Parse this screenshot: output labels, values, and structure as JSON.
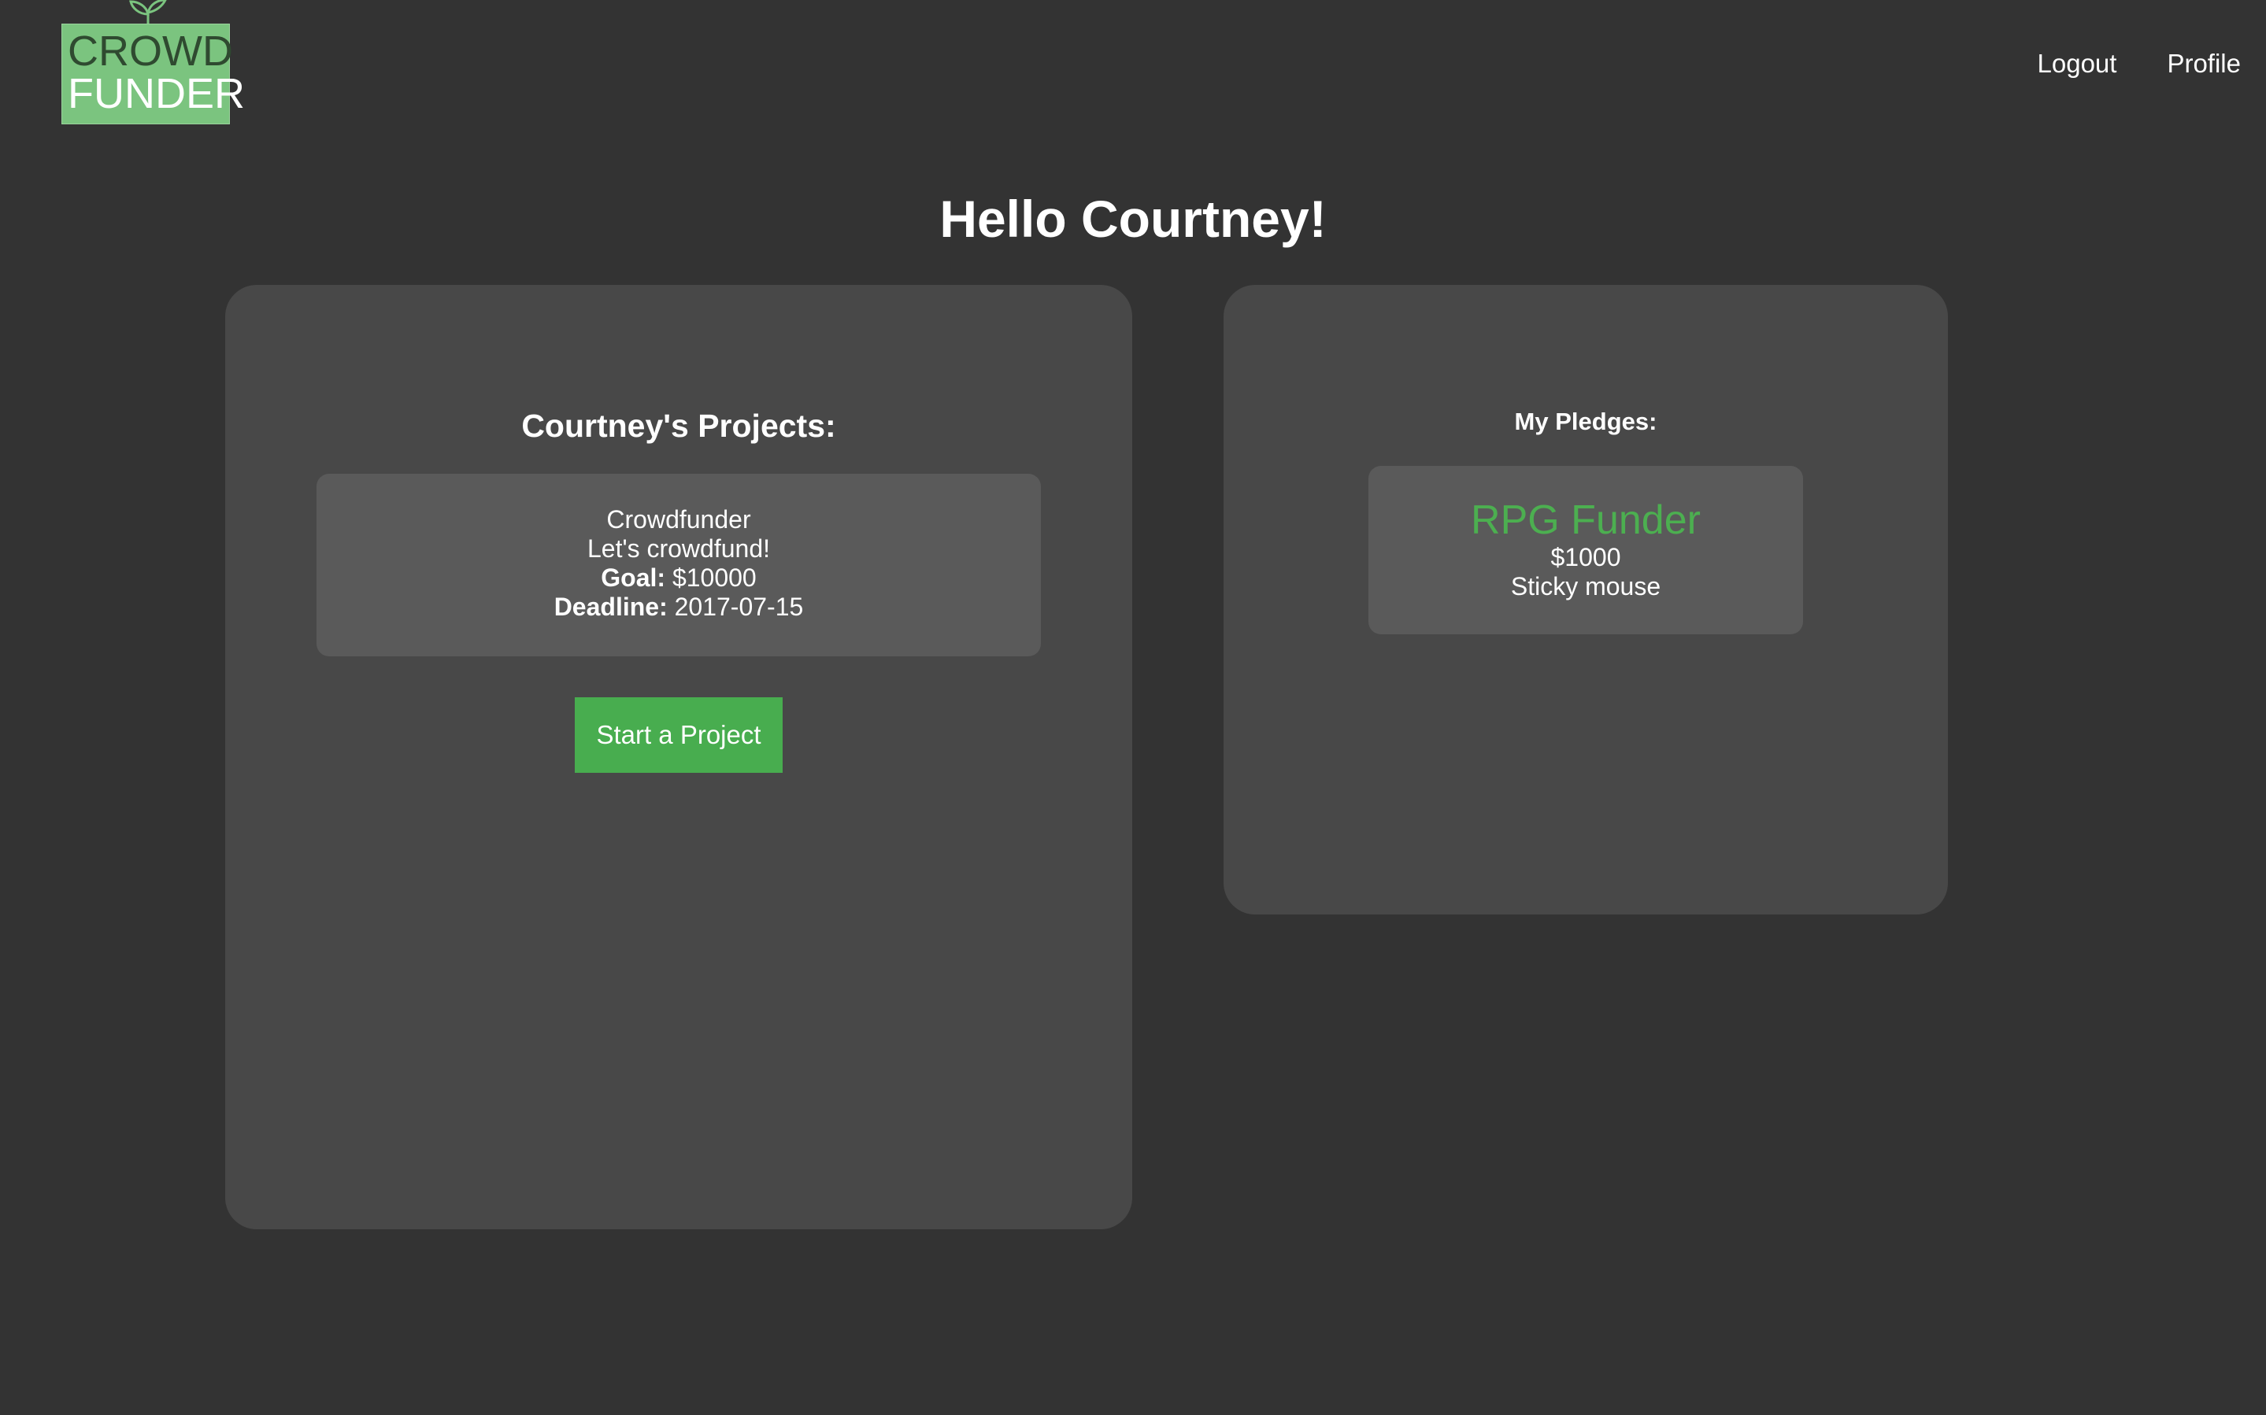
{
  "logo": {
    "line1": "CROWD",
    "line2": "FUNDER",
    "icon": "sprout-icon",
    "background_color": "#7bc47f"
  },
  "nav": {
    "logout": "Logout",
    "profile": "Profile"
  },
  "greeting": "Hello Courtney!",
  "projects": {
    "title": "Courtney's Projects:",
    "items": [
      {
        "name": "Crowdfunder",
        "description": "Let's crowdfund!",
        "goal_label": "Goal:",
        "goal": "$10000",
        "deadline_label": "Deadline:",
        "deadline": "2017-07-15"
      }
    ],
    "start_button": "Start a Project"
  },
  "pledges": {
    "title": "My Pledges:",
    "items": [
      {
        "project": "RPG Funder",
        "amount": "$1000",
        "reward": "Sticky mouse"
      }
    ]
  },
  "colors": {
    "background": "#333333",
    "panel": "#484848",
    "card": "#5a5a5a",
    "accent": "#48ad4f",
    "pledge_title": "#4caf50"
  }
}
